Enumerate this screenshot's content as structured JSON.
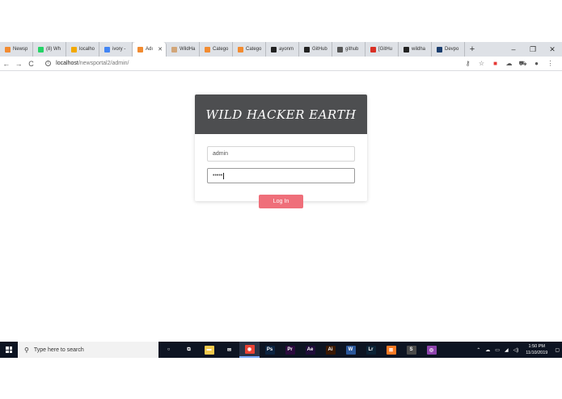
{
  "browser": {
    "tabs": [
      {
        "label": "Newsp",
        "color": "#f28b30",
        "active": false
      },
      {
        "label": "(8) Wh",
        "color": "#25d366",
        "active": false
      },
      {
        "label": "localho",
        "color": "#f2a900",
        "active": false
      },
      {
        "label": "ivory -",
        "color": "#4285f4",
        "active": false
      },
      {
        "label": "Adı",
        "color": "#f28b30",
        "active": true
      },
      {
        "label": "WildHa",
        "color": "#d2a679",
        "active": false
      },
      {
        "label": "Catego",
        "color": "#f28b30",
        "active": false
      },
      {
        "label": "Catego",
        "color": "#f28b30",
        "active": false
      },
      {
        "label": "ayonm",
        "color": "#222222",
        "active": false
      },
      {
        "label": "GitHub",
        "color": "#222222",
        "active": false
      },
      {
        "label": "github",
        "color": "#555555",
        "active": false
      },
      {
        "label": "[GitHu",
        "color": "#d93025",
        "active": false
      },
      {
        "label": "wildha",
        "color": "#222222",
        "active": false
      },
      {
        "label": "Devpo",
        "color": "#1a3d6d",
        "active": false
      }
    ],
    "new_tab": "+",
    "window_controls": {
      "minimize": "–",
      "maximize": "❐",
      "close": "✕"
    },
    "nav": {
      "back": "←",
      "forward": "→",
      "reload": "C"
    },
    "url_host": "localhost",
    "url_path": "/newsportal2/admin/"
  },
  "login": {
    "title": "WILD HACKER EARTH",
    "username_value": "admin",
    "password_value": "•••••",
    "button_label": "Log In"
  },
  "taskbar": {
    "search_placeholder": "Type here to search",
    "apps": [
      {
        "name": "cortana-icon",
        "glyph": "○",
        "bg": "transparent"
      },
      {
        "name": "task-view-icon",
        "glyph": "⧉",
        "bg": "transparent"
      },
      {
        "name": "file-explorer-icon",
        "glyph": "▬",
        "bg": "#f2c94c"
      },
      {
        "name": "mail-icon",
        "glyph": "✉",
        "bg": "transparent"
      },
      {
        "name": "chrome-icon",
        "glyph": "◉",
        "bg": "#ea4335"
      },
      {
        "name": "photoshop-icon",
        "glyph": "Ps",
        "bg": "#0b2340"
      },
      {
        "name": "premiere-icon",
        "glyph": "Pr",
        "bg": "#2a0a3d"
      },
      {
        "name": "after-effects-icon",
        "glyph": "Ae",
        "bg": "#1f0d3a"
      },
      {
        "name": "illustrator-icon",
        "glyph": "Ai",
        "bg": "#3a1800"
      },
      {
        "name": "word-icon",
        "glyph": "W",
        "bg": "#2b579a"
      },
      {
        "name": "lightroom-icon",
        "glyph": "Lr",
        "bg": "#0b2235"
      },
      {
        "name": "xampp-icon",
        "glyph": "⊠",
        "bg": "#fb7a24"
      },
      {
        "name": "sublime-icon",
        "glyph": "S",
        "bg": "#4a4a4a"
      },
      {
        "name": "app-icon",
        "glyph": "◎",
        "bg": "#8e44ad"
      }
    ],
    "time": "1:50 PM",
    "date": "11/10/2019"
  }
}
